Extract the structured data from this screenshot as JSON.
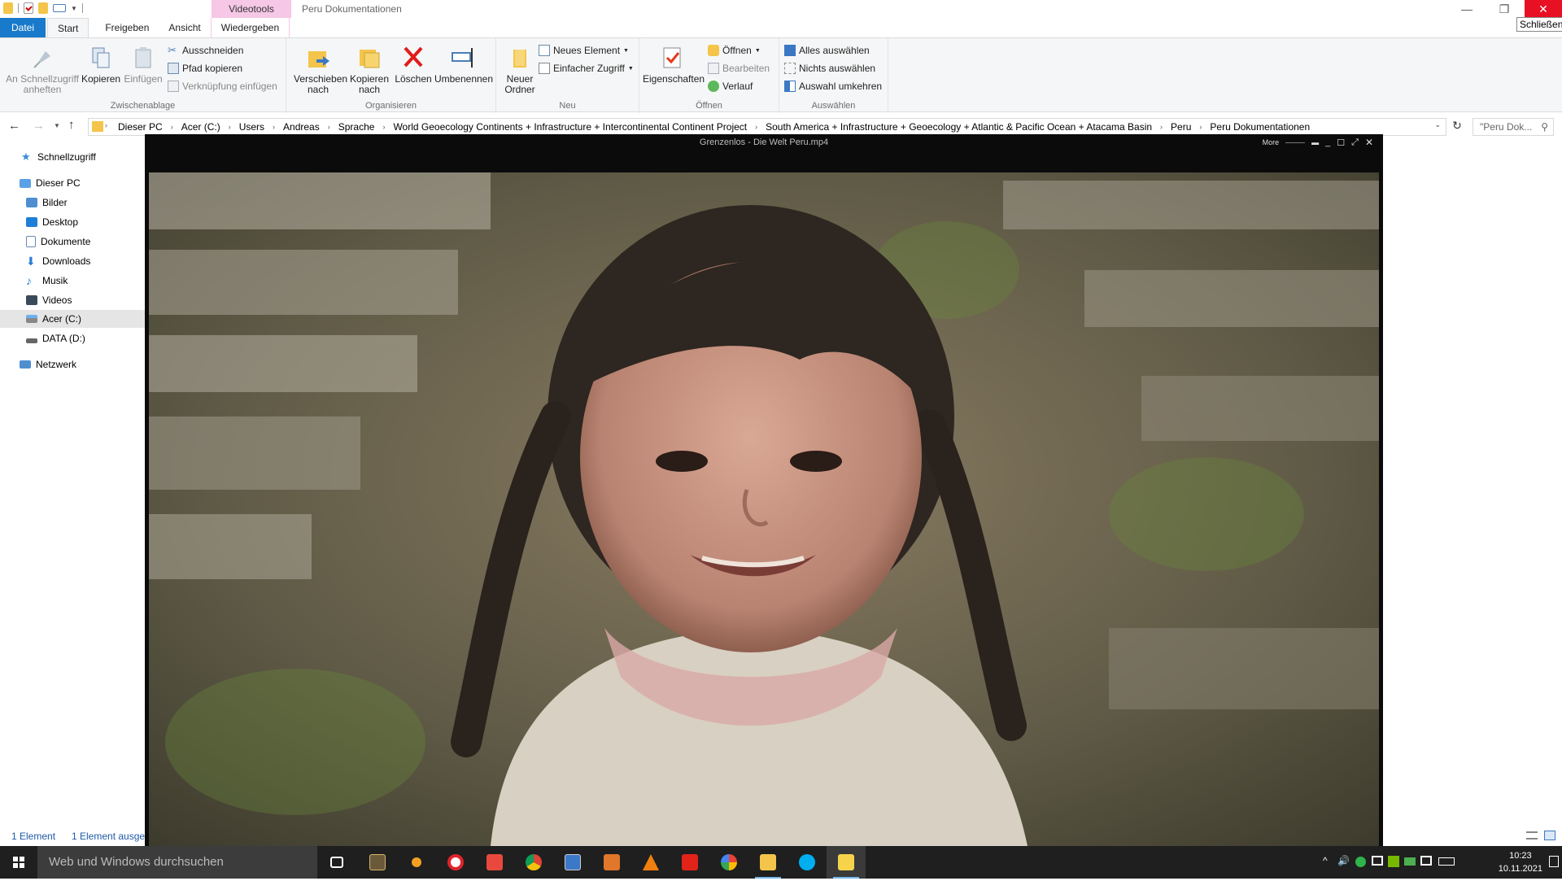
{
  "titlebar": {
    "context_group": "Videotools",
    "title": "Peru Dokumentationen",
    "tooltip": "Schließen"
  },
  "tabs": [
    {
      "label": "Datei"
    },
    {
      "label": "Start"
    },
    {
      "label": "Freigeben"
    },
    {
      "label": "Ansicht"
    },
    {
      "label": "Wiedergeben"
    }
  ],
  "ribbon": {
    "clipboard": {
      "pin": "An Schnellzugriff anheften",
      "copy": "Kopieren",
      "paste": "Einfügen",
      "cut": "Ausschneiden",
      "copy_path": "Pfad kopieren",
      "paste_shortcut": "Verknüpfung einfügen",
      "label": "Zwischenablage"
    },
    "organize": {
      "move": "Verschieben nach",
      "copy_to": "Kopieren nach",
      "delete": "Löschen",
      "rename": "Umbenennen",
      "label": "Organisieren"
    },
    "new": {
      "new_folder": "Neuer Ordner",
      "new_item": "Neues Element",
      "easy_access": "Einfacher Zugriff",
      "label": "Neu"
    },
    "open": {
      "properties": "Eigenschaften",
      "open": "Öffnen",
      "edit": "Bearbeiten",
      "history": "Verlauf",
      "label": "Öffnen"
    },
    "select": {
      "select_all": "Alles auswählen",
      "select_none": "Nichts auswählen",
      "invert": "Auswahl umkehren",
      "label": "Auswählen"
    }
  },
  "address": {
    "crumbs": [
      "Dieser PC",
      "Acer (C:)",
      "Users",
      "Andreas",
      "Sprache",
      "World Geoecology Continents + Infrastructure + Intercontinental Continent Project",
      "South America + Infrastructure + Geoecology + Atlantic & Pacific Ocean + Atacama Basin",
      "Peru",
      "Peru Dokumentationen"
    ],
    "search_placeholder": "\"Peru Dok..."
  },
  "nav": {
    "quick_access": "Schnellzugriff",
    "this_pc": "Dieser PC",
    "items": [
      "Bilder",
      "Desktop",
      "Dokumente",
      "Downloads",
      "Musik",
      "Videos",
      "Acer (C:)",
      "DATA (D:)"
    ],
    "network": "Netzwerk"
  },
  "status": {
    "count": "1 Element",
    "selected": "1 Element ausgew"
  },
  "player": {
    "title": "Grenzenlos - Die Welt Peru.mp4",
    "more": "More"
  },
  "taskbar": {
    "search_placeholder": "Web und Windows durchsuchen",
    "time": "10:23",
    "date": "10.11.2021"
  },
  "colors": {
    "accent": "#1979ca",
    "context_tab": "#f6c7e6",
    "close": "#e81123",
    "taskbar": "#1f1f1f"
  }
}
